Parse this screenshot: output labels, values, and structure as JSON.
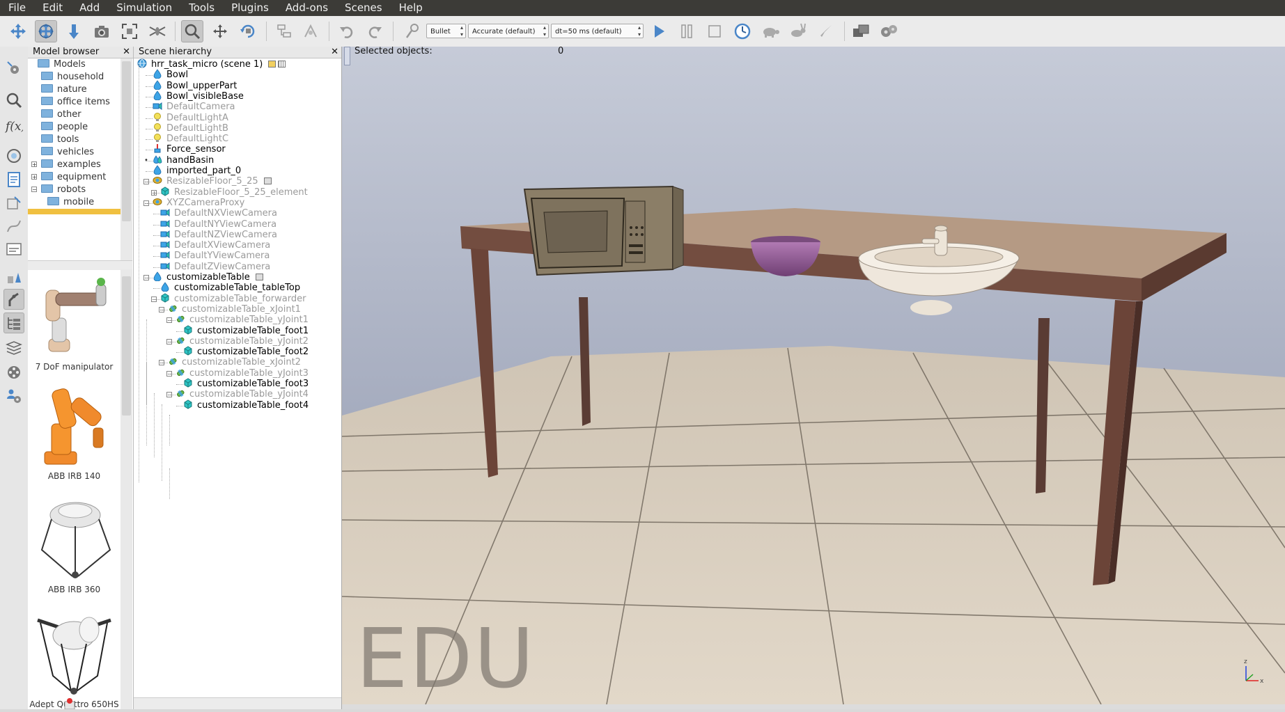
{
  "menu": [
    "File",
    "Edit",
    "Add",
    "Simulation",
    "Tools",
    "Plugins",
    "Add-ons",
    "Scenes",
    "Help"
  ],
  "toolbar": {
    "engine": "Bullet",
    "accuracy": "Accurate (default)",
    "timestep": "dt=50 ms (default)"
  },
  "model_browser": {
    "title": "Model browser",
    "tree": [
      {
        "label": "Models",
        "indent": 0,
        "expander": ""
      },
      {
        "label": "household",
        "indent": 1,
        "expander": ""
      },
      {
        "label": "nature",
        "indent": 1,
        "expander": ""
      },
      {
        "label": "office items",
        "indent": 1,
        "expander": ""
      },
      {
        "label": "other",
        "indent": 1,
        "expander": ""
      },
      {
        "label": "people",
        "indent": 1,
        "expander": ""
      },
      {
        "label": "tools",
        "indent": 1,
        "expander": ""
      },
      {
        "label": "vehicles",
        "indent": 1,
        "expander": ""
      },
      {
        "label": "examples",
        "indent": 1,
        "expander": "+"
      },
      {
        "label": "equipment",
        "indent": 1,
        "expander": "+"
      },
      {
        "label": "robots",
        "indent": 1,
        "expander": "−"
      },
      {
        "label": "mobile",
        "indent": 2,
        "expander": ""
      }
    ],
    "thumbnails": [
      {
        "label": "7 DoF manipulator"
      },
      {
        "label": "ABB IRB 140"
      },
      {
        "label": "ABB IRB 360"
      },
      {
        "label": "Adept Quattro 650HS"
      }
    ]
  },
  "scene_hierarchy": {
    "title": "Scene hierarchy",
    "rows": [
      {
        "label": "hrr_task_micro (scene 1)",
        "level": 0,
        "icon": "globe-icon",
        "dim": false,
        "expander": ""
      },
      {
        "label": "Bowl",
        "level": 1,
        "icon": "shape-icon",
        "dim": false,
        "expander": ""
      },
      {
        "label": "Bowl_upperPart",
        "level": 1,
        "icon": "shape-icon",
        "dim": false,
        "expander": ""
      },
      {
        "label": "Bowl_visibleBase",
        "level": 1,
        "icon": "shape-icon",
        "dim": false,
        "expander": ""
      },
      {
        "label": "DefaultCamera",
        "level": 1,
        "icon": "camera-icon",
        "dim": true,
        "expander": ""
      },
      {
        "label": "DefaultLightA",
        "level": 1,
        "icon": "light-icon",
        "dim": true,
        "expander": ""
      },
      {
        "label": "DefaultLightB",
        "level": 1,
        "icon": "light-icon",
        "dim": true,
        "expander": ""
      },
      {
        "label": "DefaultLightC",
        "level": 1,
        "icon": "light-icon",
        "dim": true,
        "expander": ""
      },
      {
        "label": "Force_sensor",
        "level": 1,
        "icon": "force-sensor-icon",
        "dim": false,
        "expander": ""
      },
      {
        "label": "handBasin",
        "level": 1,
        "icon": "multishape-icon",
        "dim": false,
        "expander": "•"
      },
      {
        "label": "imported_part_0",
        "level": 1,
        "icon": "shape-icon",
        "dim": false,
        "expander": ""
      },
      {
        "label": "ResizableFloor_5_25",
        "level": 1,
        "icon": "dummy-icon",
        "dim": true,
        "expander": "−"
      },
      {
        "label": "ResizableFloor_5_25_element",
        "level": 2,
        "icon": "cube-icon",
        "dim": true,
        "expander": "+"
      },
      {
        "label": "XYZCameraProxy",
        "level": 1,
        "icon": "dummy-icon",
        "dim": true,
        "expander": "−"
      },
      {
        "label": "DefaultNXViewCamera",
        "level": 2,
        "icon": "camera-icon",
        "dim": true,
        "expander": ""
      },
      {
        "label": "DefaultNYViewCamera",
        "level": 2,
        "icon": "camera-icon",
        "dim": true,
        "expander": ""
      },
      {
        "label": "DefaultNZViewCamera",
        "level": 2,
        "icon": "camera-icon",
        "dim": true,
        "expander": ""
      },
      {
        "label": "DefaultXViewCamera",
        "level": 2,
        "icon": "camera-icon",
        "dim": true,
        "expander": ""
      },
      {
        "label": "DefaultYViewCamera",
        "level": 2,
        "icon": "camera-icon",
        "dim": true,
        "expander": ""
      },
      {
        "label": "DefaultZViewCamera",
        "level": 2,
        "icon": "camera-icon",
        "dim": true,
        "expander": ""
      },
      {
        "label": "customizableTable",
        "level": 1,
        "icon": "shape-icon",
        "dim": false,
        "expander": "−"
      },
      {
        "label": "customizableTable_tableTop",
        "level": 2,
        "icon": "shape-icon",
        "dim": false,
        "expander": ""
      },
      {
        "label": "customizableTable_forwarder",
        "level": 2,
        "icon": "cube-icon",
        "dim": true,
        "expander": "−"
      },
      {
        "label": "customizableTable_xJoint1",
        "level": 3,
        "icon": "joint-icon",
        "dim": true,
        "expander": "−"
      },
      {
        "label": "customizableTable_yJoint1",
        "level": 4,
        "icon": "joint-icon",
        "dim": true,
        "expander": "−"
      },
      {
        "label": "customizableTable_foot1",
        "level": 5,
        "icon": "cube-icon",
        "dim": false,
        "expander": ""
      },
      {
        "label": "customizableTable_yJoint2",
        "level": 4,
        "icon": "joint-icon",
        "dim": true,
        "expander": "−"
      },
      {
        "label": "customizableTable_foot2",
        "level": 5,
        "icon": "cube-icon",
        "dim": false,
        "expander": ""
      },
      {
        "label": "customizableTable_xJoint2",
        "level": 3,
        "icon": "joint-icon",
        "dim": true,
        "expander": "−"
      },
      {
        "label": "customizableTable_yJoint3",
        "level": 4,
        "icon": "joint-icon",
        "dim": true,
        "expander": "−"
      },
      {
        "label": "customizableTable_foot3",
        "level": 5,
        "icon": "cube-icon",
        "dim": false,
        "expander": ""
      },
      {
        "label": "customizableTable_yJoint4",
        "level": 4,
        "icon": "joint-icon",
        "dim": true,
        "expander": "−"
      },
      {
        "label": "customizableTable_foot4",
        "level": 5,
        "icon": "cube-icon",
        "dim": false,
        "expander": ""
      }
    ]
  },
  "viewport": {
    "selected_label": "Selected objects:",
    "selected_count": "0",
    "watermark": "EDU"
  }
}
